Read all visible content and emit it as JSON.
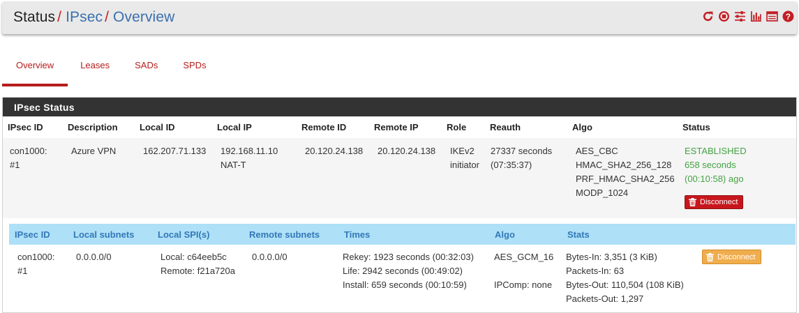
{
  "breadcrumb": {
    "root": "Status",
    "section": "IPsec",
    "page": "Overview"
  },
  "header_icons": [
    "reload-icon",
    "stop-icon",
    "sliders-icon",
    "bar-chart-icon",
    "log-icon",
    "help-icon"
  ],
  "tabs": [
    {
      "label": "Overview",
      "active": true
    },
    {
      "label": "Leases",
      "active": false
    },
    {
      "label": "SADs",
      "active": false
    },
    {
      "label": "SPDs",
      "active": false
    }
  ],
  "panel": {
    "title": "IPsec Status"
  },
  "main_table": {
    "headers": [
      "IPsec ID",
      "Description",
      "Local ID",
      "Local IP",
      "Remote ID",
      "Remote IP",
      "Role",
      "Reauth",
      "Algo",
      "Status"
    ],
    "row": {
      "ipsec_id": [
        "con1000:",
        "#1"
      ],
      "description": "Azure VPN",
      "local_id": "162.207.71.133",
      "local_ip": [
        "192.168.11.10",
        "NAT-T"
      ],
      "remote_id": "20.120.24.138",
      "remote_ip": "20.120.24.138",
      "role": [
        "IKEv2",
        "initiator"
      ],
      "reauth": [
        "27337 seconds",
        "(07:35:37)"
      ],
      "algo": [
        "AES_CBC",
        "HMAC_SHA2_256_128",
        "PRF_HMAC_SHA2_256",
        "MODP_1024"
      ],
      "status": [
        "ESTABLISHED",
        "658 seconds",
        "(00:10:58) ago"
      ],
      "disconnect_label": "Disconnect"
    }
  },
  "child_table": {
    "headers": [
      "IPsec ID",
      "Local subnets",
      "Local SPI(s)",
      "Remote subnets",
      "Times",
      "Algo",
      "Stats"
    ],
    "row": {
      "ipsec_id": [
        "con1000:",
        "#1"
      ],
      "local_subnets": "0.0.0.0/0",
      "local_spi": [
        "Local: c64eeb5c",
        "Remote: f21a720a"
      ],
      "remote_subnets": "0.0.0.0/0",
      "times": [
        "Rekey: 1923 seconds (00:32:03)",
        "Life: 2942 seconds (00:49:02)",
        "Install: 659 seconds (00:10:59)"
      ],
      "algo": [
        "AES_GCM_16",
        "",
        "IPComp: none"
      ],
      "stats": [
        "Bytes-In: 3,351 (3 KiB)",
        "Packets-In: 63",
        "Bytes-Out: 110,504 (108 KiB)",
        "Packets-Out: 1,297"
      ],
      "disconnect_label": "Disconnect"
    }
  },
  "colors": {
    "accent": "#b71c1c",
    "link": "#3a6fae",
    "heading_bg": "#333333",
    "child_header_bg": "#aee0f7",
    "established": "#44a244",
    "danger": "#c7171d",
    "warning": "#f0ad4e"
  }
}
